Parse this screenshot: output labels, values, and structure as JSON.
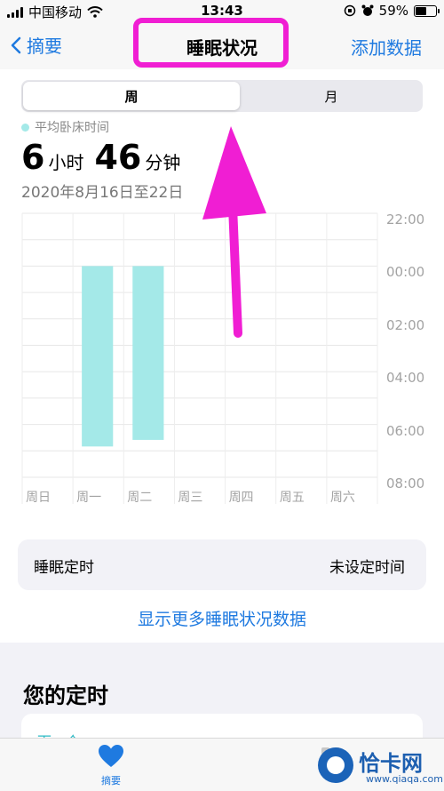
{
  "status_bar": {
    "carrier": "中国移动",
    "time": "13:43",
    "battery_percent": "59%",
    "battery_level": 0.59
  },
  "nav": {
    "back_label": "摘要",
    "title": "睡眠状况",
    "action_label": "添加数据"
  },
  "segmented_control": {
    "options": [
      "周",
      "月"
    ],
    "selected": "周"
  },
  "summary": {
    "legend_label": "平均卧床时间",
    "hours_value": "6",
    "hours_unit": "小时",
    "minutes_value": "46",
    "minutes_unit": "分钟",
    "date_range": "2020年8月16日至22日"
  },
  "chart_data": {
    "type": "bar",
    "categories": [
      "周日",
      "周一",
      "周二",
      "周三",
      "周四",
      "周五",
      "周六"
    ],
    "y_ticks": [
      "22:00",
      "00:00",
      "02:00",
      "04:00",
      "06:00",
      "08:00"
    ],
    "ylim_hours_after_22": [
      0,
      10
    ],
    "bar_color": "#a4e9e8",
    "bars": [
      {
        "category": "周一",
        "start": "00:00",
        "end": "06:50"
      },
      {
        "category": "周二",
        "start": "00:00",
        "end": "06:35"
      }
    ]
  },
  "timer_row": {
    "label": "睡眠定时",
    "value": "未设定时间"
  },
  "show_more_label": "显示更多睡眠状况数据",
  "section": {
    "title": "您的定时",
    "peek_text": "下一个"
  },
  "tab_bar": {
    "active_tab_label": "摘要"
  },
  "watermark": {
    "brand": "恰卡网",
    "url": "www.qiaqa.com"
  },
  "annotation_color": "#f01ed3",
  "accent_color": "#1f7ae0"
}
